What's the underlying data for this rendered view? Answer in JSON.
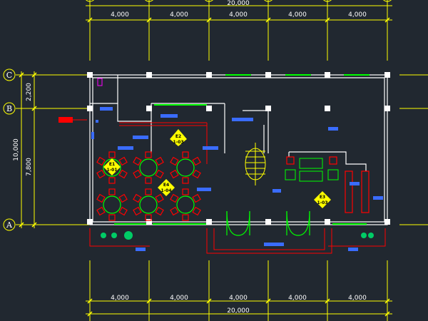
{
  "colors": {
    "background": "#212830",
    "dimension": "#ffff00",
    "wall": "#ffffff",
    "window": "#00ff00",
    "furniture": "#ff0000",
    "door": "#00ff00",
    "label": "#3a6cff",
    "tag": "#ffff00",
    "planter": "#00cc66",
    "magenta": "#ff00ff"
  },
  "dimensions": {
    "top_segments": [
      "4,000",
      "4,000",
      "4,000",
      "4,000",
      "4,000"
    ],
    "top_total": "20,000",
    "bottom_segments": [
      "4,000",
      "4,000",
      "4,000",
      "4,000",
      "4,000"
    ],
    "bottom_total": "20,000",
    "left_upper": "2,200",
    "left_lower": "7,800",
    "left_total": "10,000"
  },
  "axes": {
    "C": "C",
    "B": "B",
    "A": "A"
  },
  "tags": [
    {
      "id": "E2",
      "sub": "1-03"
    },
    {
      "id": "E1",
      "sub": "1-01"
    },
    {
      "id": "E4",
      "sub": "1-04"
    },
    {
      "id": "E3",
      "sub": "1-03"
    }
  ],
  "icons": {
    "entry_marker": "entry-arrow-icon",
    "stair": "spiral-stair-icon",
    "door": "double-swing-door-icon",
    "table": "round-table-icon",
    "planter": "planter-icon"
  }
}
